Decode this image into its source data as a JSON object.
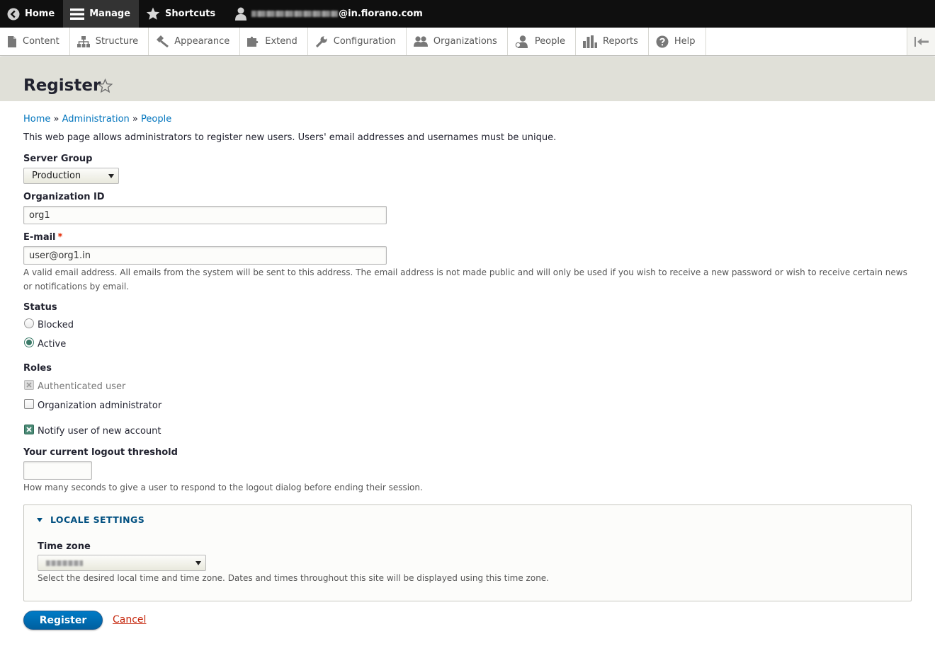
{
  "toolbar": {
    "home": "Home",
    "manage": "Manage",
    "shortcuts": "Shortcuts",
    "user_suffix": "@in.fiorano.com"
  },
  "tray": {
    "items": [
      "Content",
      "Structure",
      "Appearance",
      "Extend",
      "Configuration",
      "Organizations",
      "People",
      "Reports",
      "Help"
    ]
  },
  "page": {
    "title": "Register"
  },
  "breadcrumb": {
    "home": "Home",
    "sep1": "»",
    "admin": "Administration",
    "sep2": "»",
    "people": "People"
  },
  "intro": "This web page allows administrators to register new users. Users' email addresses and usernames must be unique.",
  "form": {
    "server_group": {
      "label": "Server Group",
      "value": "Production"
    },
    "org_id": {
      "label": "Organization ID",
      "value": "org1"
    },
    "email": {
      "label": "E-mail",
      "required_mark": "*",
      "value": "user@org1.in",
      "desc_line1": "A valid email address. All emails from the system will be sent to this address. The email address is not made public and will only be used if you wish to receive a new password or wish to receive certain news",
      "desc_line2": "or notifications by email."
    },
    "status": {
      "label": "Status",
      "blocked": "Blocked",
      "active": "Active"
    },
    "roles": {
      "label": "Roles",
      "authenticated": "Authenticated user",
      "org_admin": "Organization administrator"
    },
    "notify": "Notify user of new account",
    "logout": {
      "label": "Your current logout threshold",
      "value": "",
      "desc": "How many seconds to give a user to respond to the logout dialog before ending their session."
    },
    "locale": {
      "legend": "LOCALE SETTINGS",
      "tz_label": "Time zone",
      "tz_desc": "Select the desired local time and time zone. Dates and times throughout this site will be displayed using this time zone."
    },
    "submit": "Register",
    "cancel": "Cancel"
  },
  "colors": {
    "toolbar_bg": "#0f0f0f",
    "link": "#0074bd",
    "primary_button": "#0071b8",
    "cancel_link": "#c6280e",
    "required": "#e32700",
    "header_bg": "#e0e0d8"
  }
}
